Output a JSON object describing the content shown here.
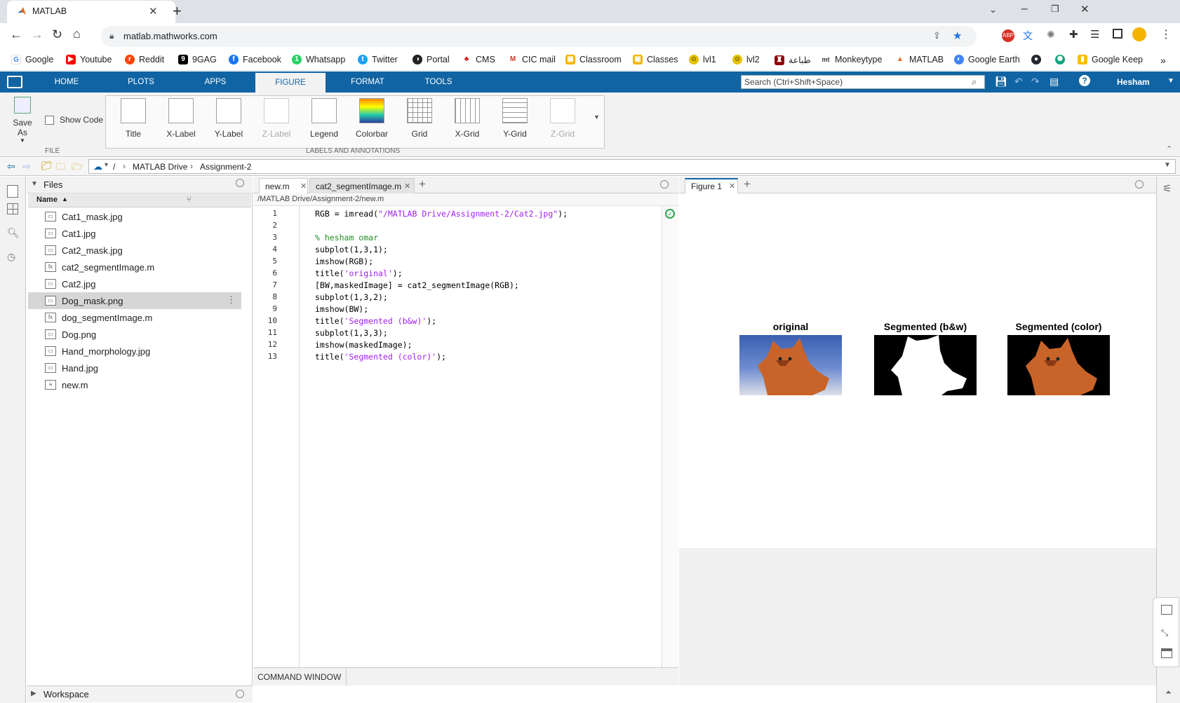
{
  "browser": {
    "tab_title": "MATLAB",
    "url": "matlab.mathworks.com",
    "bookmarks": [
      "Google",
      "Youtube",
      "Reddit",
      "9GAG",
      "Facebook",
      "Whatsapp",
      "Twitter",
      "Portal",
      "CMS",
      "CIC mail",
      "Classroom",
      "Classes",
      "lvl1",
      "lvl2",
      "طباعة",
      "Monkeytype",
      "MATLAB",
      "Google Earth",
      "Google Keep"
    ],
    "more_label": "»"
  },
  "matlab": {
    "tabs": [
      "HOME",
      "PLOTS",
      "APPS",
      "FIGURE",
      "FORMAT",
      "TOOLS"
    ],
    "active_tab": "FIGURE",
    "search_placeholder": "Search (Ctrl+Shift+Space)",
    "user": "Hesham",
    "file_section": {
      "save_as": "Save As",
      "show_code": "Show Code",
      "label": "FILE"
    },
    "labels_section": {
      "label": "LABELS AND ANNOTATIONS",
      "buttons": [
        "Title",
        "X-Label",
        "Y-Label",
        "Z-Label",
        "Legend",
        "Colorbar",
        "Grid",
        "X-Grid",
        "Y-Grid",
        "Z-Grid"
      ]
    },
    "path": {
      "root": "/",
      "drive": "MATLAB Drive",
      "folder": "Assignment-2"
    }
  },
  "files_panel": {
    "title": "Files",
    "column_name": "Name",
    "items": [
      "Cat1_mask.jpg",
      "Cat1.jpg",
      "Cat2_mask.jpg",
      "cat2_segmentImage.m",
      "Cat2.jpg",
      "Dog_mask.png",
      "dog_segmentImage.m",
      "Dog.png",
      "Hand_morphology.jpg",
      "Hand.jpg",
      "new.m"
    ],
    "selected": "Dog_mask.png",
    "workspace": "Workspace"
  },
  "editor": {
    "tabs": [
      "new.m",
      "cat2_segmentImage.m"
    ],
    "path": "/MATLAB Drive/Assignment-2/new.m",
    "line_numbers": [
      "1",
      "2",
      "3",
      "4",
      "5",
      "6",
      "7",
      "8",
      "9",
      "10",
      "11",
      "12",
      "13"
    ],
    "lines": [
      {
        "pre": "RGB = imread(",
        "str": "\"/MATLAB Drive/Assignment-2/Cat2.jpg\"",
        "post": ");"
      },
      {
        "pre": "",
        "str": "",
        "post": ""
      },
      {
        "com": "% hesham omar"
      },
      {
        "pre": "subplot(1,3,1);",
        "str": "",
        "post": ""
      },
      {
        "pre": "imshow(RGB);",
        "str": "",
        "post": ""
      },
      {
        "pre": "title(",
        "str": "'original'",
        "post": ");"
      },
      {
        "pre": "[BW,maskedImage] = cat2_segmentImage(RGB);",
        "str": "",
        "post": ""
      },
      {
        "pre": "subplot(1,3,2);",
        "str": "",
        "post": ""
      },
      {
        "pre": "imshow(BW);",
        "str": "",
        "post": ""
      },
      {
        "pre": "title(",
        "str": "'Segmented (b&w)'",
        "post": ");"
      },
      {
        "pre": "subplot(1,3,3);",
        "str": "",
        "post": ""
      },
      {
        "pre": "imshow(maskedImage);",
        "str": "",
        "post": ""
      },
      {
        "pre": "title(",
        "str": "'Segmented (color)'",
        "post": ");"
      }
    ],
    "command_window": "COMMAND WINDOW"
  },
  "figure_panel": {
    "tab": "Figure 1",
    "subplot_titles": [
      "original",
      "Segmented (b&w)",
      "Segmented (color)"
    ]
  }
}
